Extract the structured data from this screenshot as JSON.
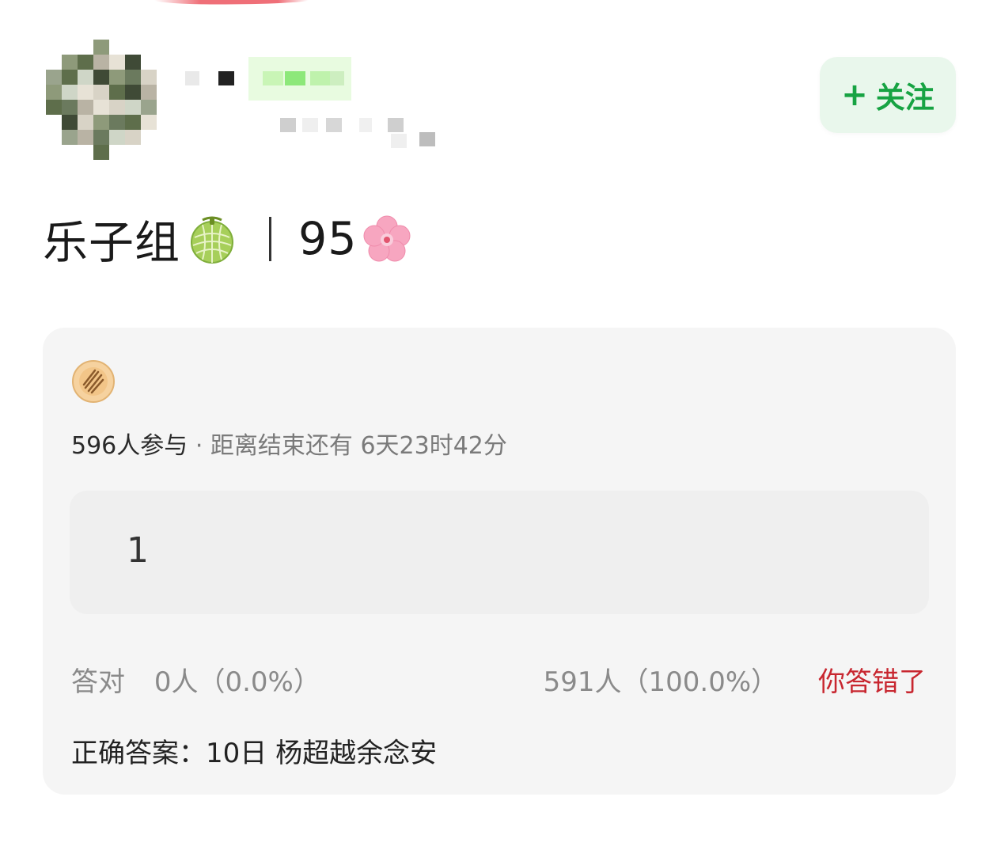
{
  "header": {
    "follow_button": {
      "label": "关注",
      "icon": "plus-icon",
      "color": "#17a343",
      "bg": "#e9f7ec"
    }
  },
  "group": {
    "name": "乐子组",
    "name_emoji": "melon-icon",
    "score": "95",
    "score_emoji": "cherry-blossom-icon"
  },
  "quiz": {
    "icon": "quiz-cookie-icon",
    "participants": "596人参与",
    "separator": "·",
    "countdown": "距离结束还有 6天23时42分",
    "user_answer": "1",
    "correct_label": "答对",
    "correct_count": "0人（0.0%）",
    "wrong_count": "591人（100.0%）",
    "result_message": "你答错了",
    "result_color": "#c8262f",
    "correct_answer": "正确答案：10日 杨超越余念安"
  }
}
